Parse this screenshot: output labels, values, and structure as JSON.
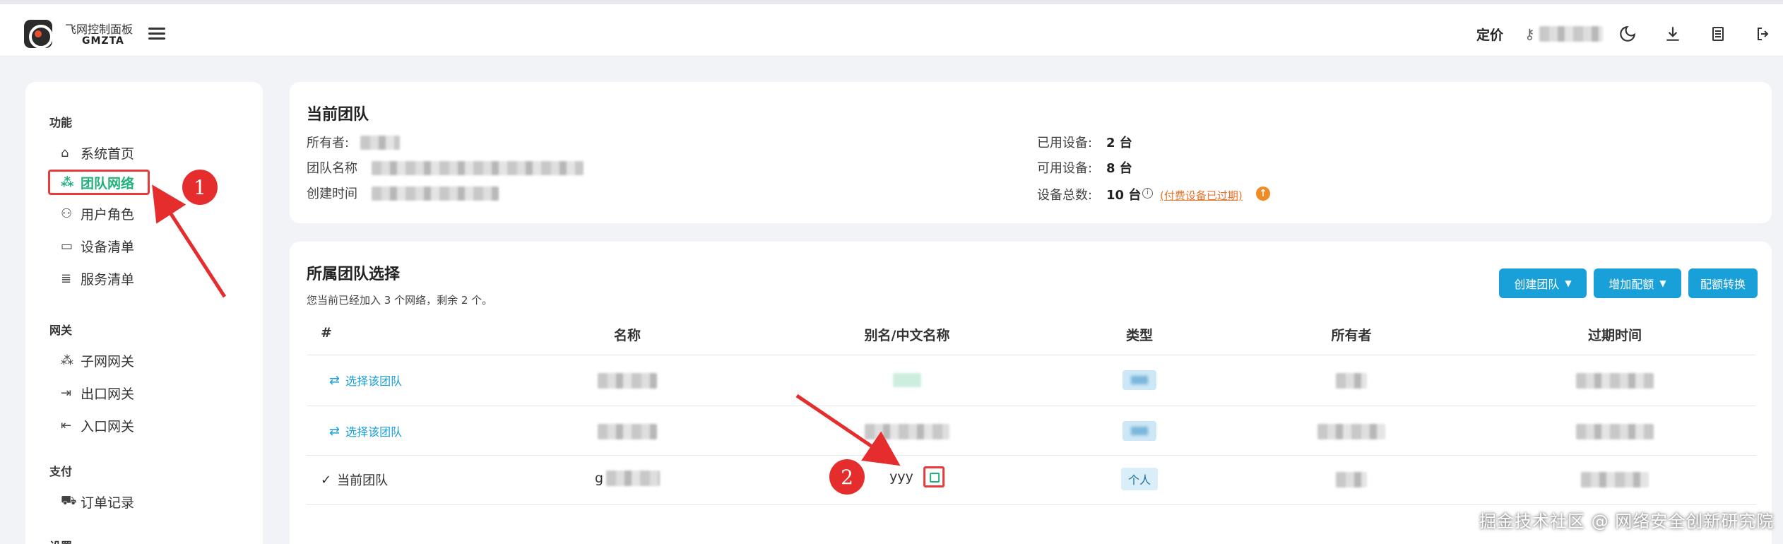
{
  "header": {
    "brand_name": "飞网控制面板",
    "brand_sub": "GMZTA",
    "pricing_label": "定价",
    "user_icon": "key-icon",
    "icons": [
      "moon-icon",
      "download-icon",
      "document-icon",
      "logout-icon"
    ]
  },
  "sidebar": {
    "sections": [
      {
        "title": "功能",
        "items": [
          {
            "label": "系统首页",
            "icon": "home-icon"
          },
          {
            "label": "团队网络",
            "icon": "network-icon",
            "active": true
          },
          {
            "label": "用户角色",
            "icon": "user-icon"
          },
          {
            "label": "设备清单",
            "icon": "monitor-icon"
          },
          {
            "label": "服务清单",
            "icon": "database-icon"
          }
        ]
      },
      {
        "title": "网关",
        "items": [
          {
            "label": "子网网关",
            "icon": "subnet-icon"
          },
          {
            "label": "出口网关",
            "icon": "exit-icon"
          },
          {
            "label": "入口网关",
            "icon": "entry-icon"
          }
        ]
      },
      {
        "title": "支付",
        "items": [
          {
            "label": "订单记录",
            "icon": "cart-icon"
          }
        ]
      },
      {
        "title": "设置",
        "items": []
      }
    ]
  },
  "current_team": {
    "title": "当前团队",
    "owner_label": "所有者:",
    "team_name_label": "团队名称",
    "created_label": "创建时间",
    "used_devices_label": "已用设备:",
    "used_devices_value": "2 台",
    "available_devices_label": "可用设备:",
    "available_devices_value": "8 台",
    "total_devices_label": "设备总数:",
    "total_devices_value": "10 台",
    "expired_link": "(付费设备已过期)",
    "upgrade_icon": "arrow-up-icon"
  },
  "team_select": {
    "title": "所属团队选择",
    "subtitle": "您当前已经加入 3 个网络，剩余 2 个。",
    "buttons": {
      "create_team": "创建团队",
      "add_quota": "增加配额",
      "quota_convert": "配额转换"
    },
    "columns": [
      "#",
      "名称",
      "别名/中文名称",
      "类型",
      "所有者",
      "过期时间"
    ],
    "rows": [
      {
        "action": "选择该团队",
        "name": "",
        "alias": "",
        "type": "",
        "owner": "",
        "expire": ""
      },
      {
        "action": "选择该团队",
        "name": "",
        "alias": "",
        "type": "",
        "owner": "",
        "expire": ""
      },
      {
        "action": "当前团队",
        "current": true,
        "name": "g",
        "alias": "yyy",
        "type": "个人",
        "owner": "",
        "expire": ""
      }
    ]
  },
  "annotations": {
    "marker1": "1",
    "marker2": "2",
    "accent_color": "#e52d2d"
  },
  "watermark": "掘金技术社区 @ 网络安全创新研究院",
  "colors": {
    "primary_button": "#1aa0d8",
    "active_nav": "#20b27a",
    "warning_link": "#e8722a"
  }
}
